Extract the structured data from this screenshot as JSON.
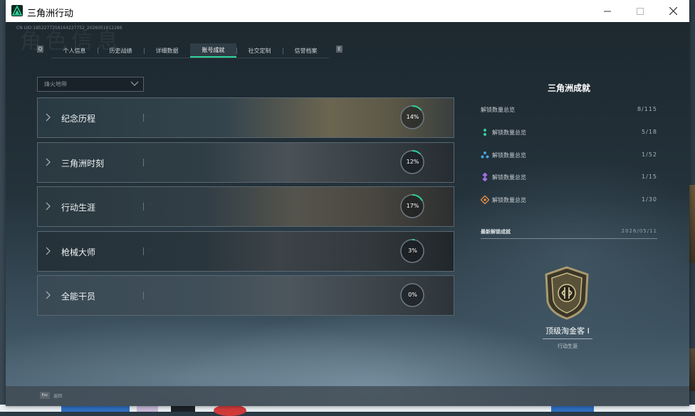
{
  "window": {
    "title": "三角洲行动",
    "uid": "CN UID:18522772581642277​52_2026051612286",
    "watermark": "角色信息"
  },
  "tabs": [
    {
      "label": "个人信息",
      "active": false
    },
    {
      "label": "历史战绩",
      "active": false
    },
    {
      "label": "详细数据",
      "active": false
    },
    {
      "label": "账号成就",
      "active": true
    },
    {
      "label": "社交定制",
      "active": false
    },
    {
      "label": "信誉档案",
      "active": false
    }
  ],
  "filter": {
    "selected": "烽火地带"
  },
  "categories": [
    {
      "label": "纪念历程",
      "progress": 14,
      "progress_text": "14%"
    },
    {
      "label": "三角洲时刻",
      "progress": 12,
      "progress_text": "12%"
    },
    {
      "label": "行动生涯",
      "progress": 17,
      "progress_text": "17%"
    },
    {
      "label": "枪械大师",
      "progress": 3,
      "progress_text": "3%"
    },
    {
      "label": "全能干员",
      "progress": 0,
      "progress_text": "0%"
    }
  ],
  "panel": {
    "title": "三角洲成就",
    "overview_label": "解锁数量总览",
    "overview_value": "8/115",
    "tiers": [
      {
        "label": "解锁数量总览",
        "value": "5/18",
        "color": "#2ed39a",
        "icon": "green-tier-icon"
      },
      {
        "label": "解锁数量总览",
        "value": "1/52",
        "color": "#4aa3e0",
        "icon": "blue-tier-icon"
      },
      {
        "label": "解锁数量总览",
        "value": "1/15",
        "color": "#a070e0",
        "icon": "purple-tier-icon"
      },
      {
        "label": "解锁数量总览",
        "value": "1/30",
        "color": "#e08a45",
        "icon": "orange-tier-icon"
      }
    ],
    "latest_label": "最新解锁成就",
    "latest_date": "2026/05/11",
    "latest_name": "顶级淘金客 I",
    "latest_category": "行动生涯"
  },
  "footer": {
    "key": "Esc",
    "label": "返回"
  },
  "colors": {
    "accent": "#2ed39a"
  }
}
